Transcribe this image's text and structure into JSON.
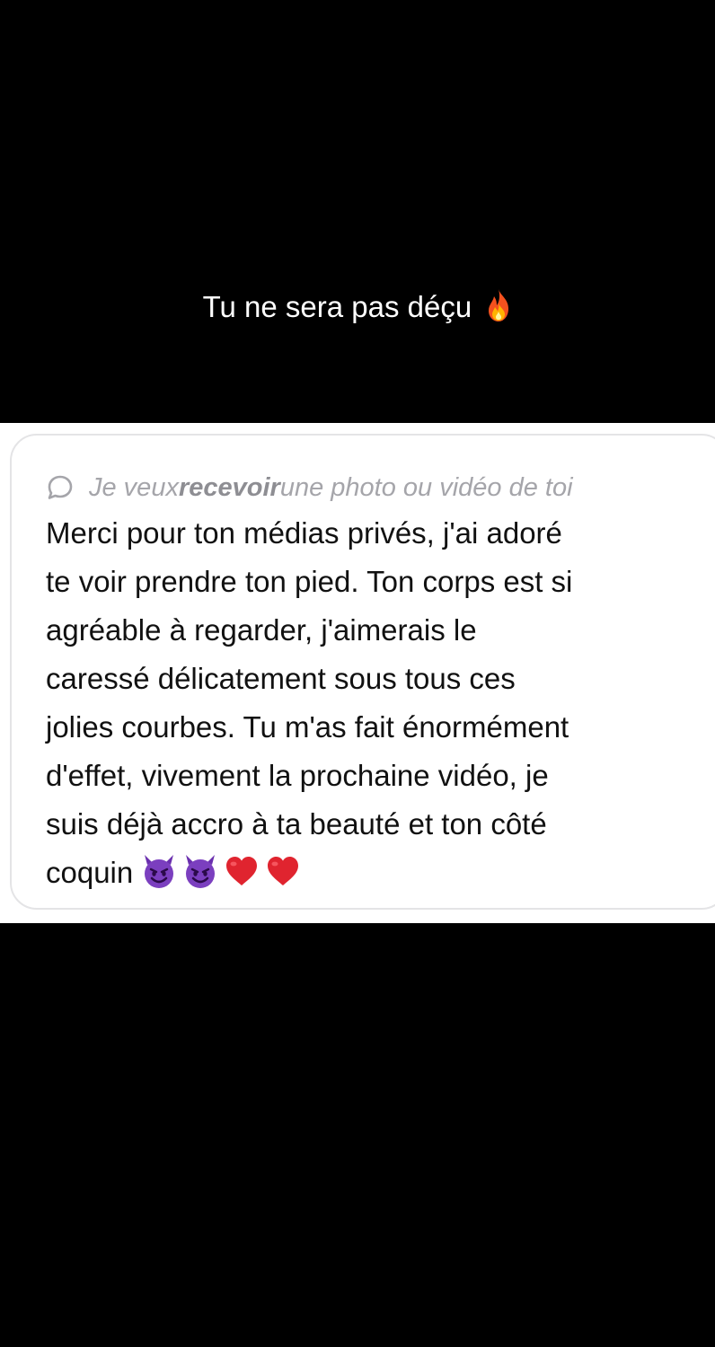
{
  "story": {
    "caption": "Tu ne sera pas déçu",
    "caption_emoji": "fire-icon"
  },
  "qa_card": {
    "question": {
      "prefix": "Je veux ",
      "emphasis": "recevoir",
      "suffix": " une photo ou vidéo de toi",
      "icon": "speech-bubble-icon"
    },
    "answer_lines": [
      "Merci pour ton médias privés, j'ai adoré",
      "te voir prendre ton pied. Ton corps est si",
      "agréable à regarder, j'aimerais le",
      "caressé délicatement sous tous ces",
      "jolies courbes. Tu m'as fait énormément",
      "d'effet, vivement la prochaine vidéo, je",
      "suis déjà accro à ta beauté et ton côté",
      "coquin"
    ],
    "answer_emojis": [
      "smiling-devil-icon",
      "smiling-devil-icon",
      "red-heart-icon",
      "red-heart-icon"
    ]
  },
  "colors": {
    "background": "#000000",
    "card": "#ffffff",
    "question_text": "#a5a5aa",
    "answer_text": "#111111",
    "devil_purple": "#7b3fbf",
    "heart_red": "#e0242f"
  }
}
